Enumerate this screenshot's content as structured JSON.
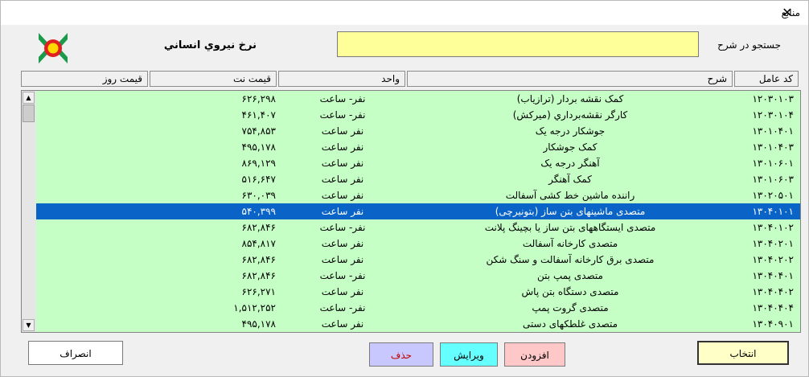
{
  "window": {
    "title": "منابع",
    "close_glyph": "✕"
  },
  "header": {
    "rate_label": "نرخ نيروي انساني",
    "search_label": "جستجو در شرح",
    "search_value": ""
  },
  "columns": {
    "code": "کد عامل",
    "desc": "شرح",
    "unit": "واحد",
    "net": "قیمت نت",
    "day": "قیمت روز"
  },
  "rows": [
    {
      "code": "۱۲۰۳۰۱۰۳",
      "desc": "کمک نقشه بردار (ترازیاب)",
      "unit": "نفر- ساعت",
      "net": "۶۲۶,۲۹۸",
      "day": ""
    },
    {
      "code": "۱۲۰۳۰۱۰۴",
      "desc": "کارگر نقشه‌برداري (ميرکش)",
      "unit": "نفر- ساعت",
      "net": "۴۶۱,۴۰۷",
      "day": ""
    },
    {
      "code": "۱۳۰۱۰۴۰۱",
      "desc": "جوشکار درجه یک",
      "unit": "نفر ساعت",
      "net": "۷۵۴,۸۵۳",
      "day": ""
    },
    {
      "code": "۱۳۰۱۰۴۰۳",
      "desc": "کمک جوشکار",
      "unit": "نفر ساعت",
      "net": "۴۹۵,۱۷۸",
      "day": ""
    },
    {
      "code": "۱۳۰۱۰۶۰۱",
      "desc": "آهنگر درجه یک",
      "unit": "نفر ساعت",
      "net": "۸۶۹,۱۲۹",
      "day": ""
    },
    {
      "code": "۱۳۰۱۰۶۰۳",
      "desc": "کمک آهنگر",
      "unit": "نفر ساعت",
      "net": "۵۱۶,۶۴۷",
      "day": ""
    },
    {
      "code": "۱۳۰۲۰۵۰۱",
      "desc": "راننده ماشین خط کشی آسفالت",
      "unit": "نفر ساعت",
      "net": "۶۳۰,۰۳۹",
      "day": ""
    },
    {
      "code": "۱۳۰۴۰۱۰۱",
      "desc": "متصدی ماشینهای بتن ساز (بتونیرچی)",
      "unit": "نفر ساعت",
      "net": "۵۴۰,۳۹۹",
      "day": "",
      "selected": true
    },
    {
      "code": "۱۳۰۴۰۱۰۲",
      "desc": "متصدی ایستگاههای بتن ساز یا بچینگ پلانت",
      "unit": "نفر- ساعت",
      "net": "۶۸۲,۸۴۶",
      "day": ""
    },
    {
      "code": "۱۳۰۴۰۲۰۱",
      "desc": "متصدی کارخانه آسفالت",
      "unit": "نفر ساعت",
      "net": "۸۵۴,۸۱۷",
      "day": ""
    },
    {
      "code": "۱۳۰۴۰۲۰۲",
      "desc": "متصدی برق کارخانه آسفالت و سنگ شکن",
      "unit": "نفر ساعت",
      "net": "۶۸۲,۸۴۶",
      "day": ""
    },
    {
      "code": "۱۳۰۴۰۴۰۱",
      "desc": "متصدی پمپ بتن",
      "unit": "نفر- ساعت",
      "net": "۶۸۲,۸۴۶",
      "day": ""
    },
    {
      "code": "۱۳۰۴۰۴۰۲",
      "desc": "متصدی دستگاه بتن پاش",
      "unit": "نفر ساعت",
      "net": "۶۲۶,۲۷۱",
      "day": ""
    },
    {
      "code": "۱۳۰۴۰۴۰۴",
      "desc": "متصدی گروت پمپ",
      "unit": "نفر- ساعت",
      "net": "۱,۵۱۲,۲۵۲",
      "day": ""
    },
    {
      "code": "۱۳۰۴۰۹۰۱",
      "desc": "متصدی غلطکهای دستی",
      "unit": "نفر ساعت",
      "net": "۴۹۵,۱۷۸",
      "day": ""
    }
  ],
  "scroll": {
    "up_glyph": "▲",
    "down_glyph": "▼"
  },
  "buttons": {
    "cancel": "انصراف",
    "delete": "حذف",
    "edit": "ویرایش",
    "add": "افزودن",
    "select": "انتخاب"
  },
  "logo_icon": "logo-icon",
  "colors": {
    "row_bg": "#c6ffc6",
    "selected_bg": "#0a64c8",
    "search_bg": "#ffff99",
    "delete_bg": "#c8c8ff",
    "edit_bg": "#66ffff",
    "add_bg": "#ffc8c8",
    "select_bg": "#ffffc8"
  }
}
